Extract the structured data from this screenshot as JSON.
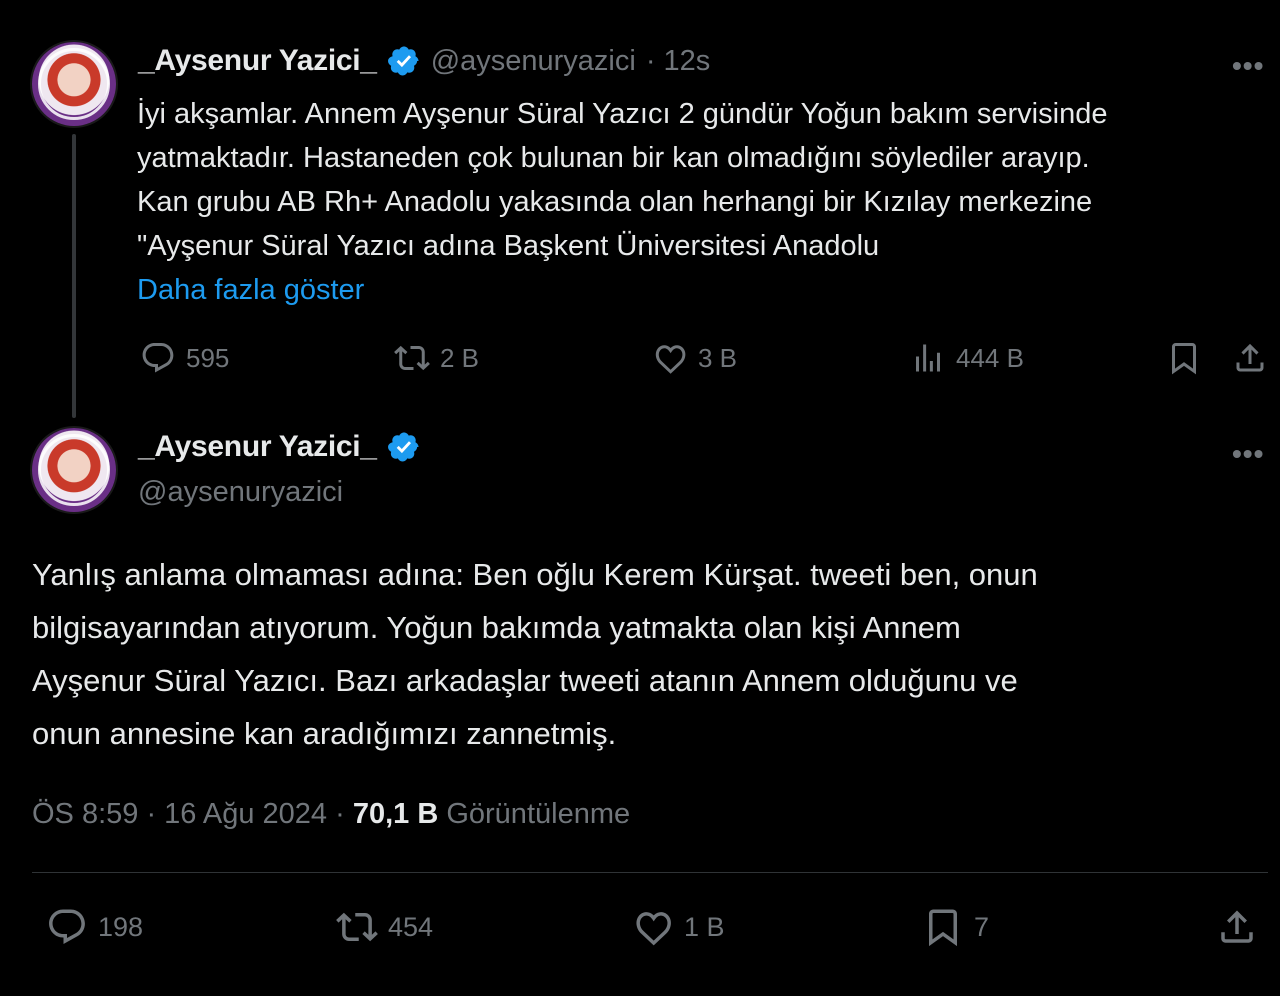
{
  "tweet1": {
    "display_name": "_Aysenur Yazici_",
    "handle": "@aysenuryazici",
    "time": "· 12s",
    "lines": [
      "İyi akşamlar. Annem Ayşenur Süral Yazıcı 2 gündür Yoğun bakım servisinde",
      "yatmaktadır. Hastaneden çok bulunan bir kan olmadığını söylediler arayıp.",
      "Kan grubu AB Rh+ Anadolu yakasında olan  herhangi bir Kızılay merkezine",
      "\"Ayşenur Süral Yazıcı adına Başkent Üniversitesi Anadolu"
    ],
    "show_more": "Daha fazla göster",
    "replies": "595",
    "retweets": "2 B",
    "likes": "3 B",
    "views": "444 B"
  },
  "tweet2": {
    "display_name": "_Aysenur Yazici_",
    "handle": "@aysenuryazici",
    "lines": [
      "Yanlış anlama olmaması adına: Ben oğlu Kerem Kürşat. tweeti ben,  onun",
      "bilgisayarından atıyorum. Yoğun bakımda yatmakta olan kişi Annem",
      "Ayşenur Süral Yazıcı. Bazı arkadaşlar tweeti atanın Annem olduğunu ve",
      "onun annesine kan aradığımızı zannetmiş."
    ],
    "timestamp": "ÖS 8:59 · 16 Ağu 2024 · ",
    "view_count": "70,1 B",
    "view_label": " Görüntülenme",
    "replies": "198",
    "retweets": "454",
    "likes": "1 B",
    "bookmarks": "7"
  },
  "icons": {
    "verified": "verified-badge-icon",
    "more": "more-dots-icon",
    "reply": "reply-icon",
    "retweet": "retweet-icon",
    "like": "heart-icon",
    "views": "views-icon",
    "bookmark": "bookmark-icon",
    "share": "share-icon"
  },
  "colors": {
    "background": "#000000",
    "text": "#e7e9ea",
    "muted": "#71767b",
    "link": "#1d9bf0",
    "verified": "#1d9bf0"
  }
}
